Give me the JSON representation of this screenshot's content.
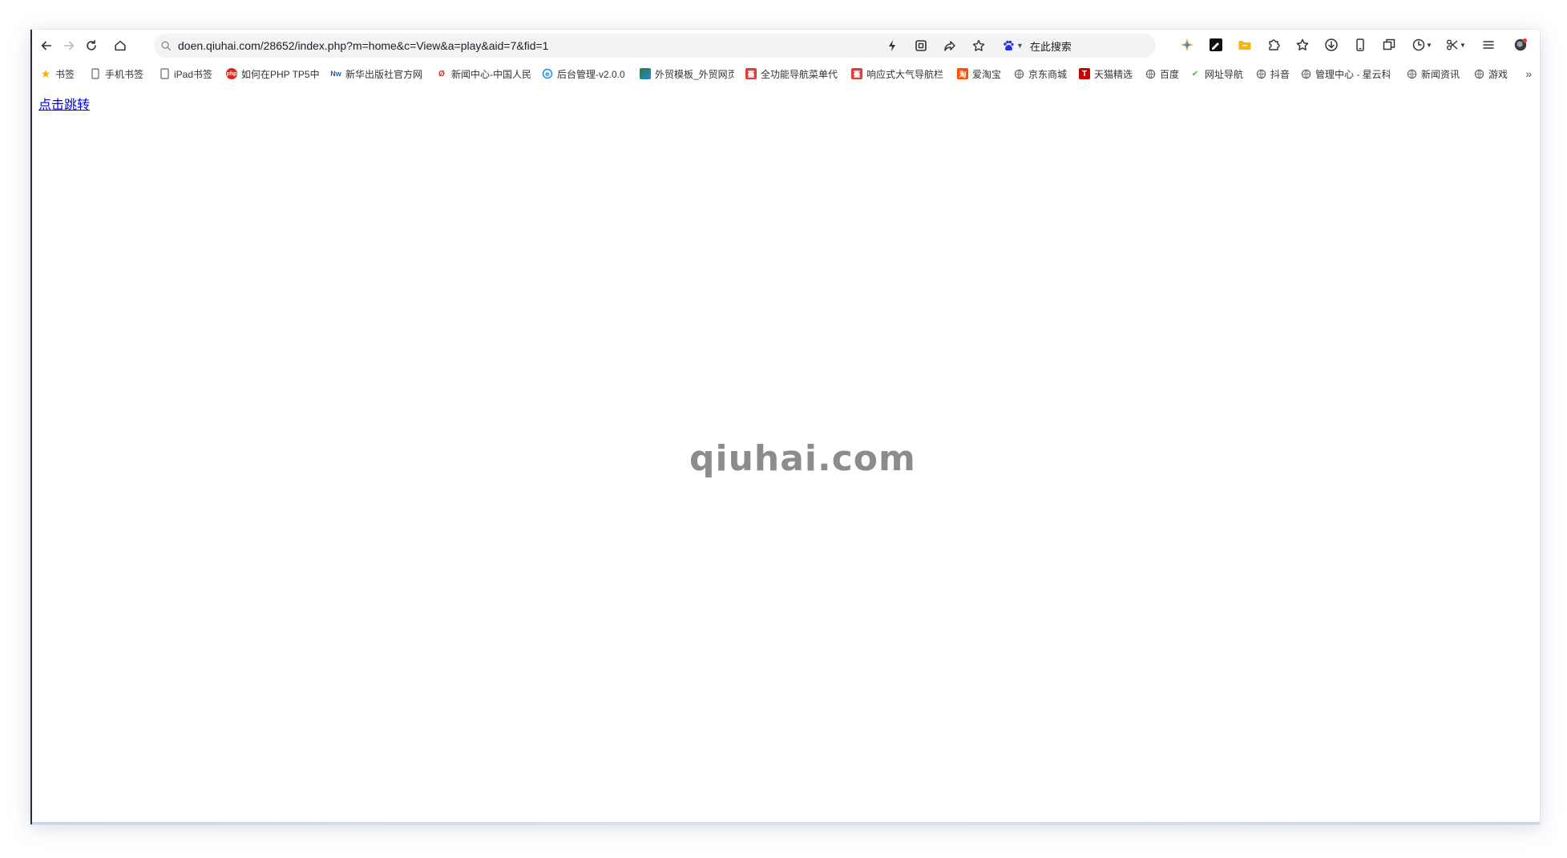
{
  "toolbar": {
    "url": "doen.qiuhai.com/28652/index.php?m=home&c=View&a=play&aid=7&fid=1",
    "search_engine_label": "在此搜索"
  },
  "bookmarks": {
    "items": [
      {
        "label": "书签",
        "icon": "star-icon",
        "color": "#f5b400"
      },
      {
        "label": "手机书签",
        "icon": "phone-icon",
        "color": "#666666"
      },
      {
        "label": "iPad书签",
        "icon": "tablet-icon",
        "color": "#666666"
      },
      {
        "label": "如何在PHP TP5中",
        "icon": "php-icon",
        "color": "#d9251c"
      },
      {
        "label": "新华出版社官方网",
        "icon": "xinhua-icon",
        "color": "#1a5fb4"
      },
      {
        "label": "新闻中心-中国人民",
        "icon": "news-icon",
        "color": "#c0392b"
      },
      {
        "label": "后台管理-v2.0.0",
        "icon": "admin-icon",
        "color": "#1e88e5"
      },
      {
        "label": "外贸模板_外贸网页",
        "icon": "template-icon",
        "color": "#2e7d32"
      },
      {
        "label": "全功能导航菜单代",
        "icon": "menu-icon",
        "color": "#e53935"
      },
      {
        "label": "响应式大气导航栏",
        "icon": "nav-icon",
        "color": "#e53935"
      },
      {
        "label": "爱淘宝",
        "icon": "taobao-icon",
        "color": "#ff5000"
      },
      {
        "label": "京东商城",
        "icon": "globe-icon",
        "color": "#666666"
      },
      {
        "label": "天猫精选",
        "icon": "tmall-icon",
        "color": "#c40000"
      },
      {
        "label": "百度",
        "icon": "globe-icon",
        "color": "#666666"
      },
      {
        "label": "网址导航",
        "icon": "hao-icon",
        "color": "#4caf50"
      },
      {
        "label": "抖音",
        "icon": "globe-icon",
        "color": "#666666"
      },
      {
        "label": "管理中心 - 星云科",
        "icon": "globe-icon",
        "color": "#666666"
      },
      {
        "label": "新闻资讯",
        "icon": "globe-icon",
        "color": "#666666"
      },
      {
        "label": "游戏",
        "icon": "globe-icon",
        "color": "#666666"
      }
    ],
    "more_label": "»"
  },
  "content": {
    "link_text": "点击跳转",
    "watermark": "qiuhai.com"
  }
}
